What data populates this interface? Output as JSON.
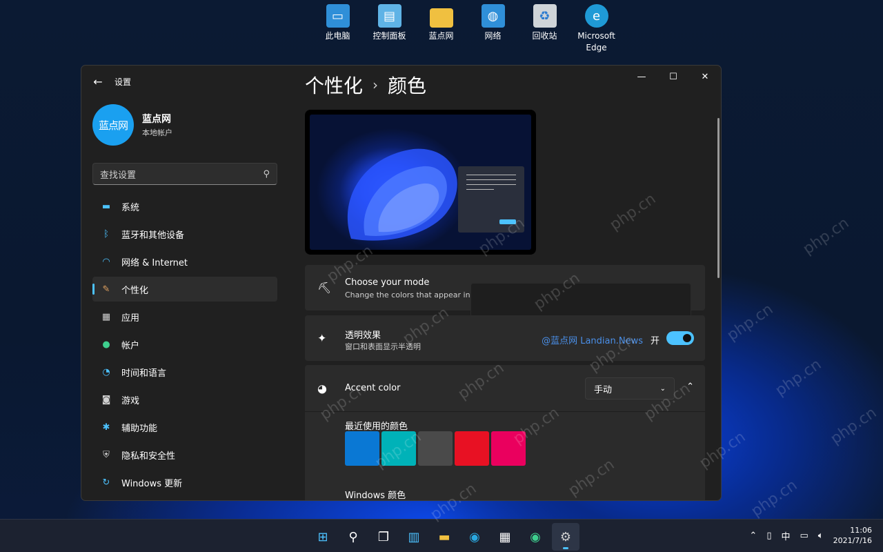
{
  "desktop": {
    "icons": [
      {
        "label": "此电脑",
        "icon": "monitor-icon",
        "color": "#3aa0e8"
      },
      {
        "label": "控制面板",
        "icon": "control-panel-icon",
        "color": "#5fb3e6"
      },
      {
        "label": "蓝点网",
        "icon": "folder-icon",
        "color": "#f0c040"
      },
      {
        "label": "网络",
        "icon": "network-icon",
        "color": "#3aa0e8"
      },
      {
        "label": "回收站",
        "icon": "recycle-bin-icon",
        "color": "#d8d8d8"
      },
      {
        "label": "Microsoft Edge",
        "icon": "edge-icon",
        "color": "#2aa8e0"
      }
    ]
  },
  "window": {
    "title": "设置",
    "profile": {
      "avatar_text": "蓝点网",
      "name": "蓝点网",
      "account_type": "本地帐户"
    },
    "search": {
      "placeholder": "查找设置"
    },
    "nav": [
      {
        "label": "系统",
        "icon": "display-icon",
        "color": "#4cc2ff"
      },
      {
        "label": "蓝牙和其他设备",
        "icon": "bluetooth-icon",
        "color": "#4cc2ff"
      },
      {
        "label": "网络 & Internet",
        "icon": "wifi-icon",
        "color": "#4cc2ff"
      },
      {
        "label": "个性化",
        "icon": "brush-icon",
        "color": "#e0a060"
      },
      {
        "label": "应用",
        "icon": "apps-icon",
        "color": "#cfcfcf"
      },
      {
        "label": "帐户",
        "icon": "account-icon",
        "color": "#3ecf8e"
      },
      {
        "label": "时间和语言",
        "icon": "clock-globe-icon",
        "color": "#4cc2ff"
      },
      {
        "label": "游戏",
        "icon": "gamepad-icon",
        "color": "#cfcfcf"
      },
      {
        "label": "辅助功能",
        "icon": "accessibility-icon",
        "color": "#4cc2ff"
      },
      {
        "label": "隐私和安全性",
        "icon": "shield-icon",
        "color": "#cfcfcf"
      },
      {
        "label": "Windows 更新",
        "icon": "update-icon",
        "color": "#4cc2ff"
      }
    ],
    "active_nav_index": 3,
    "breadcrumb": {
      "parent": "个性化",
      "current": "颜色"
    },
    "mode_card": {
      "title": "Choose your mode",
      "desc": "Change the colors that appear in"
    },
    "transparency_card": {
      "title": "透明效果",
      "desc": "窗口和表面显示半透明",
      "watermark_text": "@蓝点网 Landian.News",
      "state": "开"
    },
    "accent_card": {
      "title": "Accent color",
      "dropdown_value": "手动",
      "recent_label": "最近使用的颜色",
      "windows_colors_label": "Windows 颜色",
      "recent_colors": [
        "#0a78d4",
        "#00b2b8",
        "#4a4a4a",
        "#e81123",
        "#ea005e"
      ]
    }
  },
  "taskbar": {
    "apps": [
      {
        "icon": "windows-start-icon",
        "glyph": "⊞",
        "color": "#4cc2ff"
      },
      {
        "icon": "search-icon",
        "glyph": "⚲",
        "color": "#ffffff"
      },
      {
        "icon": "task-view-icon",
        "glyph": "❐",
        "color": "#ffffff"
      },
      {
        "icon": "widgets-icon",
        "glyph": "▥",
        "color": "#4cc2ff"
      },
      {
        "icon": "file-explorer-icon",
        "glyph": "▬",
        "color": "#f0c040"
      },
      {
        "icon": "edge-icon",
        "glyph": "◉",
        "color": "#2aa8e0"
      },
      {
        "icon": "store-icon",
        "glyph": "▦",
        "color": "#ffffff"
      },
      {
        "icon": "edge-canary-icon",
        "glyph": "◉",
        "color": "#3ecf8e"
      },
      {
        "icon": "settings-icon",
        "glyph": "⚙",
        "color": "#cfcfcf"
      }
    ],
    "tray": {
      "ime": "中"
    },
    "clock": {
      "time": "11:06",
      "date": "2021/7/16"
    }
  }
}
